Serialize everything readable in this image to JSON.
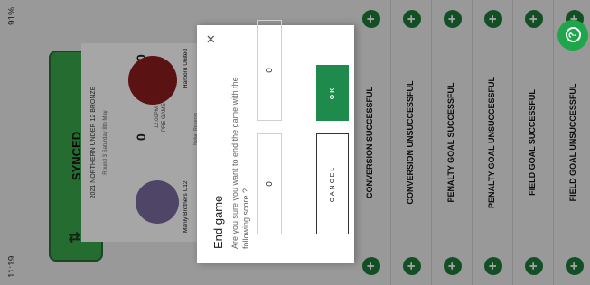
{
  "status_bar": {
    "time": "11:19",
    "battery": "91%"
  },
  "sync": {
    "label": "SYNCED"
  },
  "game": {
    "competition": "2021 NORTHERN UNDER 12 BRONZE",
    "round": "Round 3 Saturday 8th May",
    "home_score": "0",
    "away_score": "0",
    "kickoff_time": "12:00PM",
    "game_status": "PRE GAME",
    "home_team": "Manly Brothers U12",
    "away_team": "Harbord United",
    "venue": "Nolan Reserve"
  },
  "score_rows": [
    {
      "label": "CONVERSION SUCCESSFUL"
    },
    {
      "label": "CONVERSION UNSUCCESSFUL"
    },
    {
      "label": "PENALTY GOAL SUCCESSFUL"
    },
    {
      "label": "PENALTY GOAL UNSUCCESSFUL"
    },
    {
      "label": "FIELD GOAL SUCCESSFUL"
    },
    {
      "label": "FIELD GOAL UNSUCCESSFUL"
    }
  ],
  "dialog": {
    "title": "End game",
    "message": "Are you sure you want to end the game with the following score ?",
    "home_score": "0",
    "away_score": "0",
    "cancel_label": "CANCEL",
    "ok_label": "OK"
  },
  "colors": {
    "accent": "#1e8a4c",
    "sync_green": "#3aa64a"
  },
  "icons": {
    "fab": "help-icon",
    "close": "close-icon",
    "sync": "sync-arrows-icon",
    "add": "plus-icon"
  }
}
